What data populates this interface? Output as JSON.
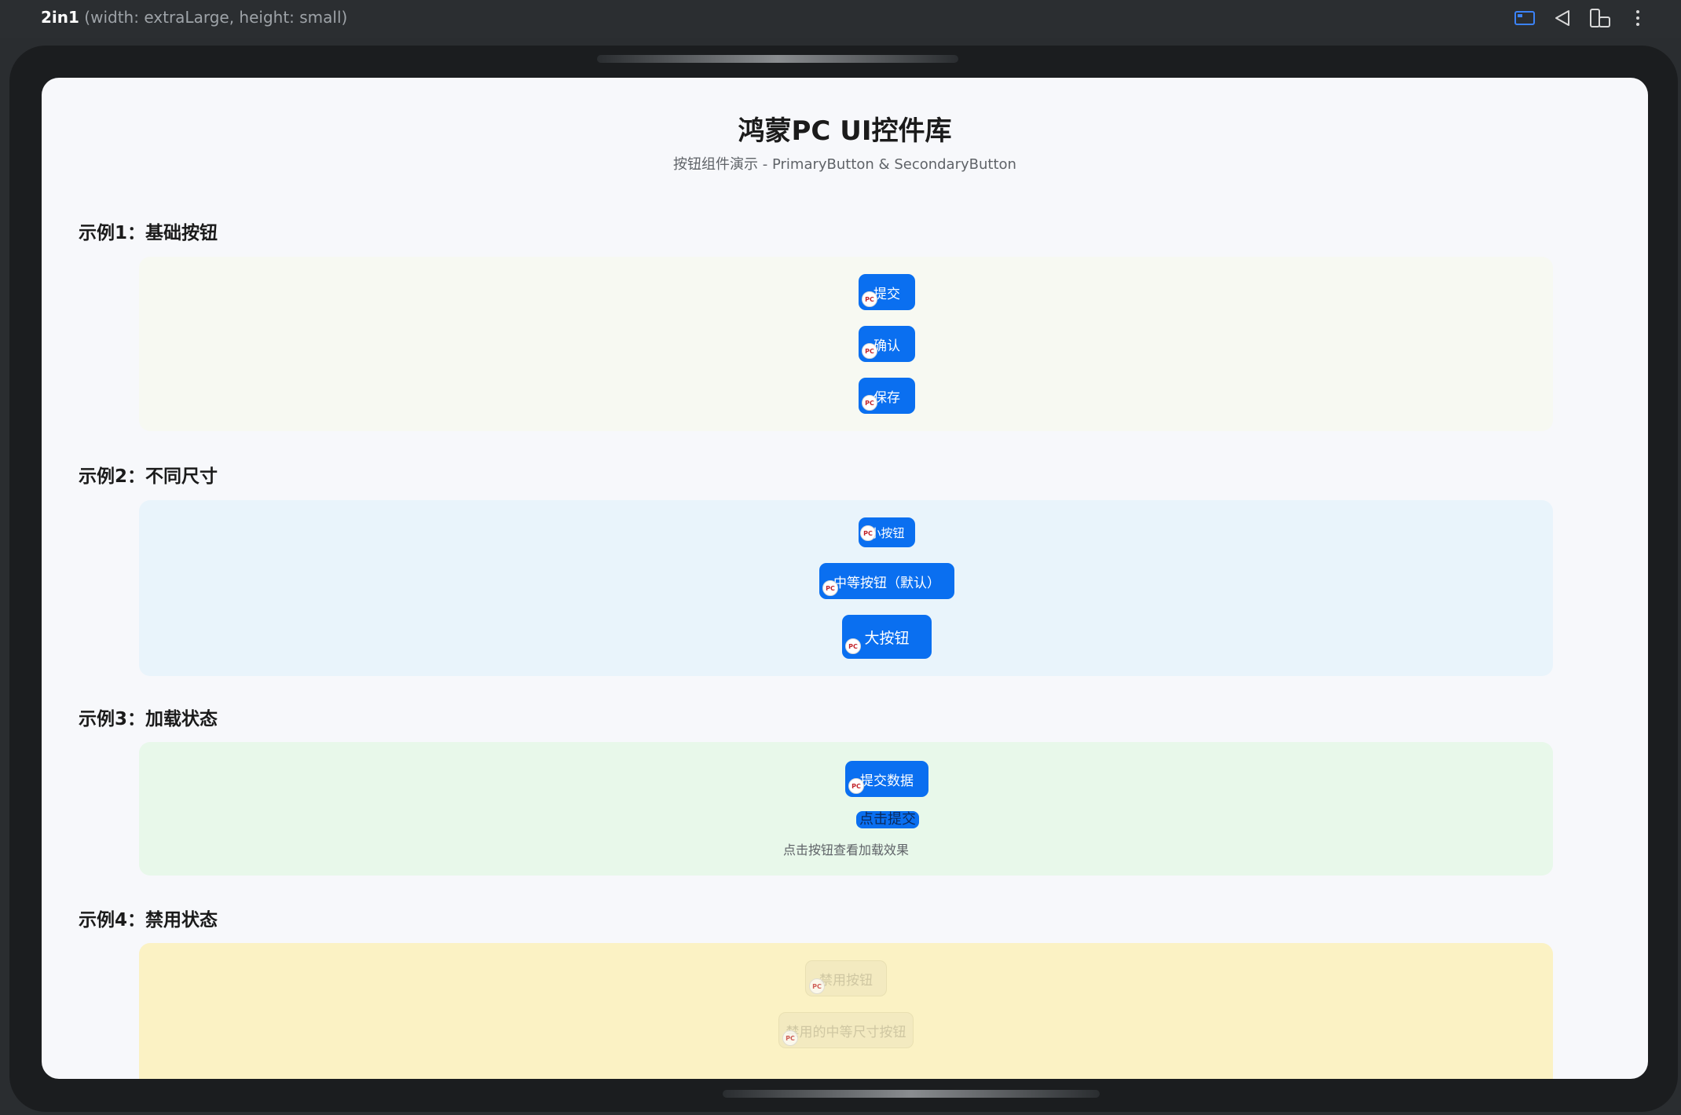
{
  "window": {
    "device_label": "2in1",
    "device_detail": "(width: extraLarge, height: small)",
    "toolbar_icons": [
      "window-mode-icon",
      "back-triangle-icon",
      "device-rotate-icon",
      "more-vertical-icon"
    ]
  },
  "page": {
    "title": "鸿蒙PC UI控件库",
    "subtitle": "按钮组件演示 - PrimaryButton & SecondaryButton"
  },
  "badge_text": "PC",
  "sections": [
    {
      "title": "示例1：基础按钮",
      "buttons": [
        "提交",
        "确认",
        "保存"
      ]
    },
    {
      "title": "示例2：不同尺寸",
      "buttons": [
        "小按钮",
        "中等按钮（默认）",
        "大按钮"
      ]
    },
    {
      "title": "示例3：加载状态",
      "buttons": [
        "提交数据"
      ],
      "link": "点击提交",
      "hint": "点击按钮查看加载效果"
    },
    {
      "title": "示例4：禁用状态",
      "buttons": [
        "禁用按钮",
        "禁用的中等尺寸按钮"
      ]
    }
  ],
  "colors": {
    "primary": "#0a6ff0",
    "panel1": "#f7f9f2",
    "panel2": "#e9f4fb",
    "panel3": "#e8f8ea",
    "panel4": "#fbf2c4"
  }
}
